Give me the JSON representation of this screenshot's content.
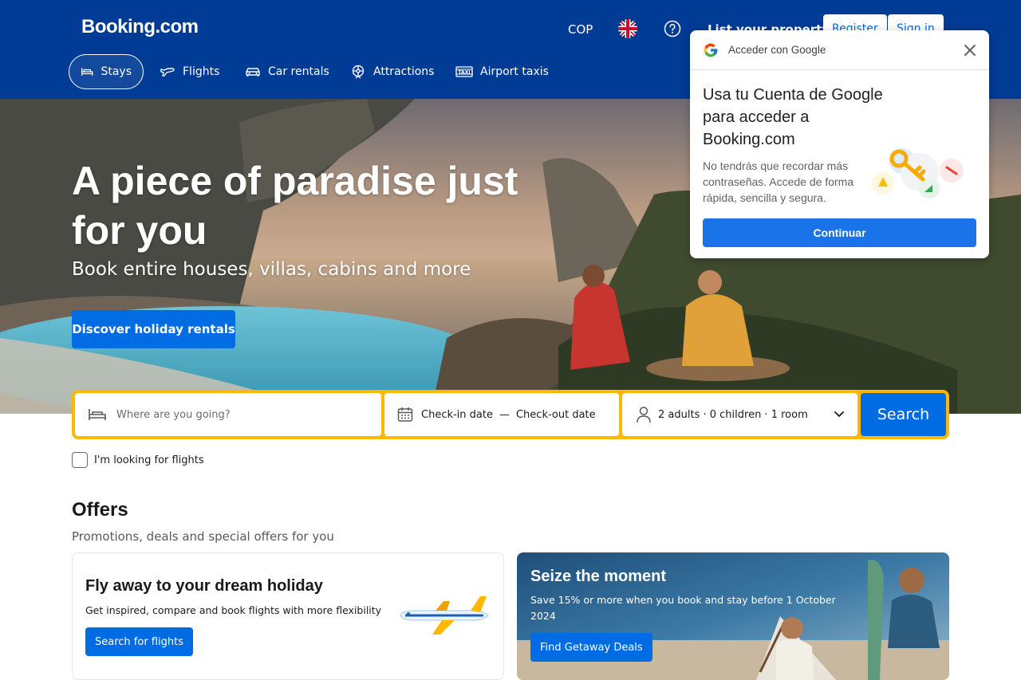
{
  "header": {
    "logo": "Booking.com",
    "currency": "COP",
    "list_property": "List your property",
    "register": "Register",
    "sign_in": "Sign in"
  },
  "nav": [
    {
      "label": "Stays",
      "active": true
    },
    {
      "label": "Flights",
      "active": false
    },
    {
      "label": "Car rentals",
      "active": false
    },
    {
      "label": "Attractions",
      "active": false
    },
    {
      "label": "Airport taxis",
      "active": false
    }
  ],
  "hero": {
    "title": "A piece of paradise just for you",
    "subtitle": "Book entire houses, villas, cabins and more",
    "cta": "Discover holiday rentals"
  },
  "search": {
    "destination_placeholder": "Where are you going?",
    "checkin": "Check-in date",
    "separator": "—",
    "checkout": "Check-out date",
    "occupancy": "2 adults · 0 children · 1 room",
    "button": "Search"
  },
  "flights_checkbox": "I'm looking for flights",
  "offers": {
    "title": "Offers",
    "subtitle": "Promotions, deals and special offers for you",
    "card1": {
      "title": "Fly away to your dream holiday",
      "text": "Get inspired, compare and book flights with more flexibility",
      "button": "Search for flights"
    },
    "card2": {
      "title": "Seize the moment",
      "text": "Save 15% or more when you book and stay before 1 October 2024",
      "button": "Find Getaway Deals"
    }
  },
  "google_popup": {
    "header": "Acceder con Google",
    "title": "Usa tu Cuenta de Google para acceder a Booking.com",
    "text": "No tendrás que recordar más contraseñas. Accede de forma rápida, sencilla y segura.",
    "button": "Continuar"
  },
  "colors": {
    "brand_blue": "#003b95",
    "action_blue": "#006ce4",
    "search_yellow": "#ffb700",
    "google_blue": "#1a73e8"
  }
}
